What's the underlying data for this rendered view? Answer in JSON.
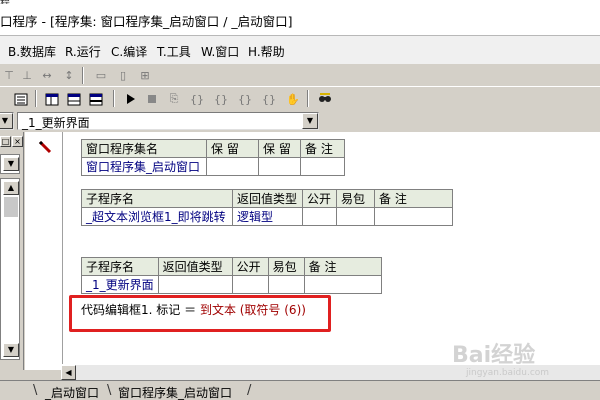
{
  "window": {
    "partial_top": "程",
    "title": "口程序 - [程序集: 窗口程序集_启动窗口 / _启动窗口]"
  },
  "menu": [
    {
      "label": "B.数据库"
    },
    {
      "label": "R.运行"
    },
    {
      "label": "C.编译"
    },
    {
      "label": "T.工具"
    },
    {
      "label": "W.窗口"
    },
    {
      "label": "H.帮助"
    }
  ],
  "toolbar2": {
    "icons": [
      "list-icon",
      "table-view-icon",
      "panel-view-icon",
      "split-view-icon",
      "run-icon",
      "stop-icon",
      "step-icon",
      "step-into-icon",
      "step-over-icon",
      "step-out-icon",
      "run-to-cursor-icon",
      "hand-icon",
      "find-icon"
    ]
  },
  "selectors": {
    "left_value": "",
    "main_value": "_1_更新界面"
  },
  "tables": {
    "assembly": {
      "headers": [
        "窗口程序集名",
        "保 留",
        "保 留",
        "备 注"
      ],
      "row": [
        "窗口程序集_启动窗口",
        "",
        "",
        ""
      ]
    },
    "sub1": {
      "headers": [
        "子程序名",
        "返回值类型",
        "公开",
        "易包",
        "备 注"
      ],
      "row": [
        "_超文本浏览框1_即将跳转",
        "逻辑型",
        "",
        "",
        ""
      ]
    },
    "sub2": {
      "headers": [
        "子程序名",
        "返回值类型",
        "公开",
        "易包",
        "备 注"
      ],
      "row": [
        "_1_更新界面",
        "",
        "",
        "",
        ""
      ]
    }
  },
  "code": {
    "object": "代码编辑框1. 标记",
    "operator": "＝",
    "expression": "到文本 (取符号 (6))"
  },
  "tabs": [
    {
      "label": "_启动窗口"
    },
    {
      "label": "窗口程序集_启动窗口"
    }
  ],
  "watermark": {
    "text": "Bai经验",
    "url": "jingyan.baidu.com"
  },
  "colors": {
    "highlight": "#e02020",
    "header_bg": "#e6ecdf",
    "value_text": "#000080"
  }
}
